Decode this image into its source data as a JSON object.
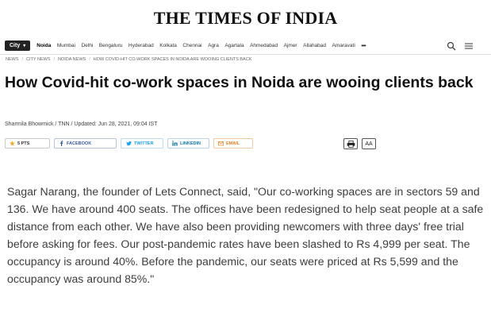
{
  "masthead": "THE TIMES OF INDIA",
  "city_badge": "City",
  "nav_items": [
    "Noida",
    "Mumbai",
    "Delhi",
    "Bengaluru",
    "Hyderabad",
    "Kolkata",
    "Chennai",
    "Agra",
    "Agartala",
    "Ahmedabad",
    "Ajmer",
    "Allahabad",
    "Amaravati"
  ],
  "nav_more": "•••",
  "nav_tools": {
    "search_icon": "search-icon",
    "menu_icon": "hamburger-menu-icon"
  },
  "breadcrumb": [
    "NEWS",
    "CITY NEWS",
    "NOIDA NEWS",
    "HOW COVID-HIT CO-WORK SPACES IN NOIDA ARE WOOING CLIENTS BACK"
  ],
  "headline": "How Covid-hit co-work spaces in Noida are wooing clients back",
  "byline": "Sharmila Bhowmick / TNN / Updated: Jun 28, 2021, 09:04 IST",
  "share": {
    "points": "5 PTS",
    "facebook": "FACEBOOK",
    "twitter": "TWITTER",
    "linkedin": "LINKEDIN",
    "email": "EMAIL"
  },
  "right_tools": {
    "print_icon": "print-icon",
    "font_size": "AA"
  },
  "article_body": "Sagar Narang, the founder of Lets Connect, said, \"Our co-working spaces are in sectors 59 and 136. We have around 400 seats. The offices have been redesigned to help seat people at a safe distance from each other. We have also been providing newcomers with three days' free trial before asking for fees. Our post-pandemic rates have been slashed to Rs 4,999 per seat. The occupancy is around 40%. Before the pandemic, our seats were priced at Rs 5,599 and the occupancy was around 85%.\"",
  "colors": {
    "facebook": "#3b5998",
    "twitter": "#1da1f2",
    "linkedin": "#0e76a8",
    "email": "#e67e22",
    "points_star": "#f5a623"
  }
}
